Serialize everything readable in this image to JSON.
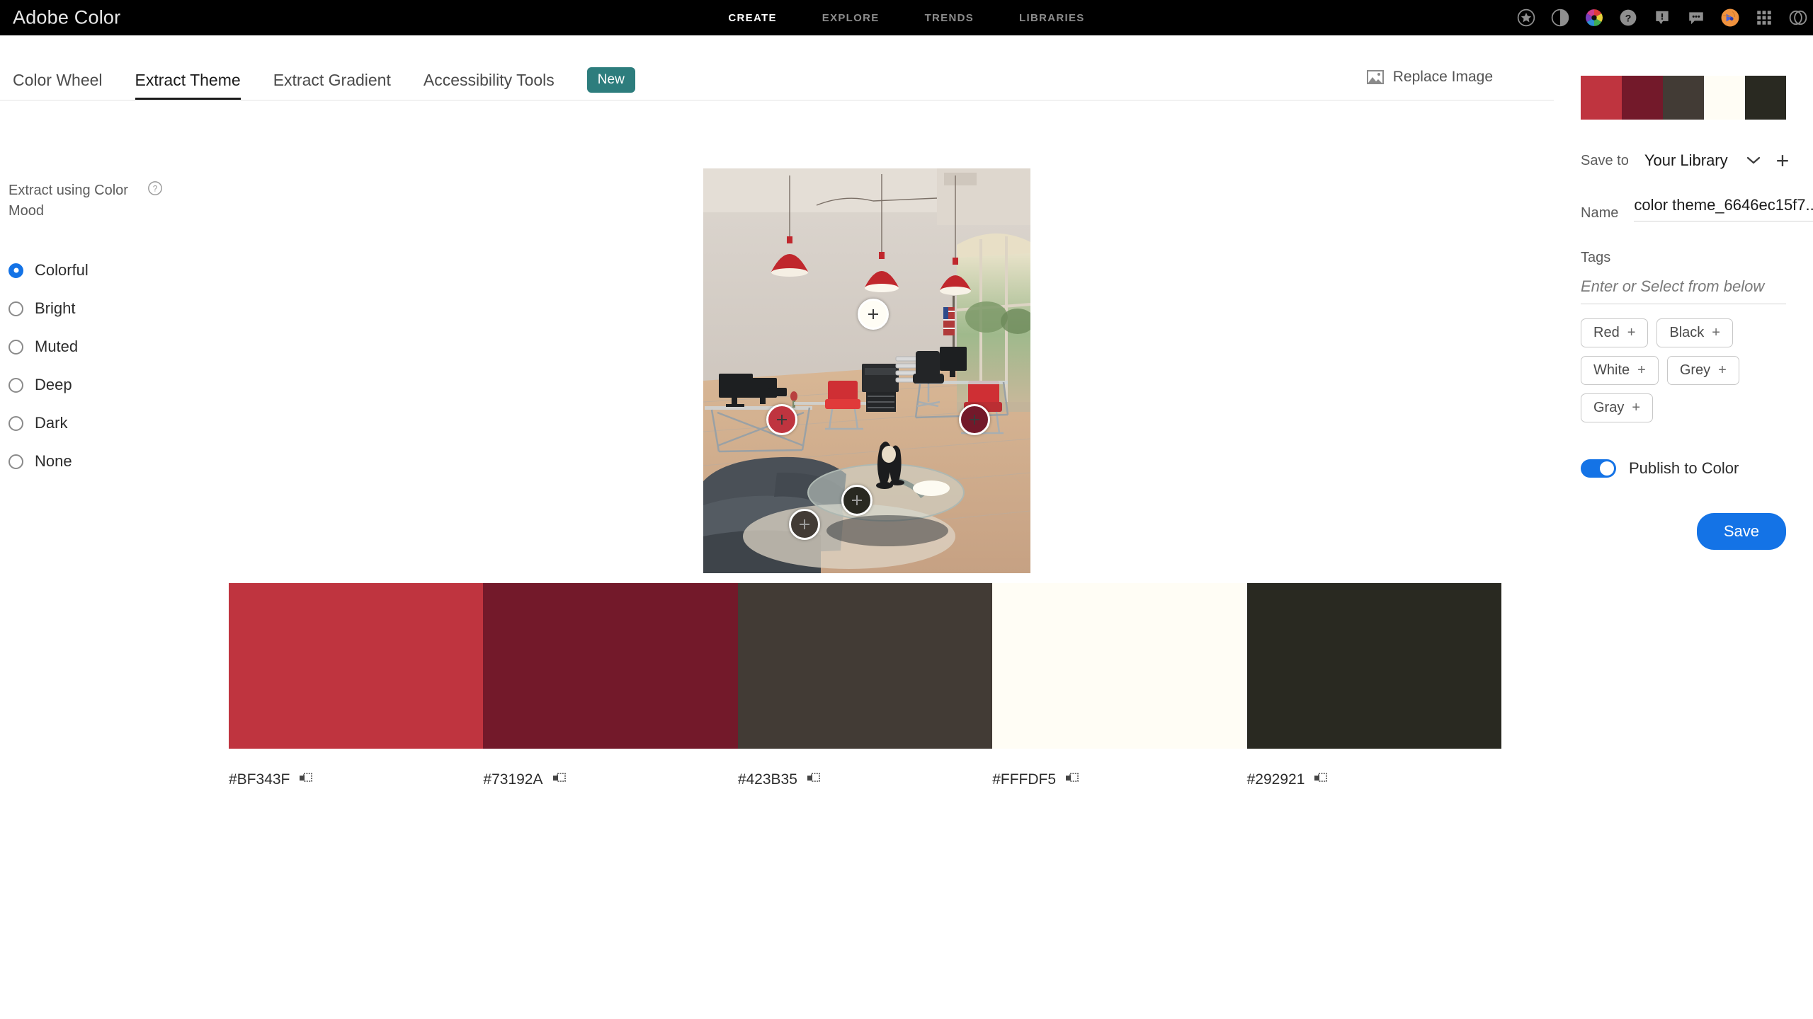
{
  "app": {
    "brand": "Adobe Color"
  },
  "topnav": {
    "items": [
      {
        "label": "CREATE",
        "active": true
      },
      {
        "label": "EXPLORE",
        "active": false
      },
      {
        "label": "TRENDS",
        "active": false
      },
      {
        "label": "LIBRARIES",
        "active": false
      }
    ],
    "icons": [
      "star-icon",
      "contrast-icon",
      "color-wheel-icon",
      "help-icon",
      "notification-icon",
      "chat-icon",
      "avatar",
      "app-grid-icon",
      "creative-cloud-icon"
    ]
  },
  "tabs": {
    "items": [
      {
        "label": "Color Wheel",
        "active": false
      },
      {
        "label": "Extract Theme",
        "active": true
      },
      {
        "label": "Extract Gradient",
        "active": false
      },
      {
        "label": "Accessibility Tools",
        "active": false
      }
    ],
    "badge": "New",
    "badge_color": "#2d7d7d",
    "replace_image": "Replace Image"
  },
  "left_panel": {
    "title": "Extract using Color Mood",
    "help_icon": "help-circle-icon",
    "options": [
      {
        "label": "Colorful",
        "selected": true
      },
      {
        "label": "Bright",
        "selected": false
      },
      {
        "label": "Muted",
        "selected": false
      },
      {
        "label": "Deep",
        "selected": false
      },
      {
        "label": "Dark",
        "selected": false
      },
      {
        "label": "None",
        "selected": false
      }
    ],
    "selected_color": "#1473e6"
  },
  "theme": {
    "swatches": [
      {
        "hex": "#BF343F",
        "copy_icon": "copy-icon"
      },
      {
        "hex": "#73192A",
        "copy_icon": "copy-icon"
      },
      {
        "hex": "#423B35",
        "copy_icon": "copy-icon"
      },
      {
        "hex": "#FFFDF5",
        "copy_icon": "copy-icon"
      },
      {
        "hex": "#292921",
        "copy_icon": "copy-icon"
      }
    ]
  },
  "image": {
    "description": "office interior with red pendant lamps",
    "markers": [
      {
        "x": 52,
        "y": 36,
        "size": 44,
        "fill": "#FFFDF5"
      },
      {
        "x": 24,
        "y": 62,
        "size": 44,
        "fill": "#BF343F"
      },
      {
        "x": 83,
        "y": 62,
        "size": 44,
        "fill": "#73192A"
      },
      {
        "x": 31,
        "y": 88,
        "size": 44,
        "fill": "#423B35"
      },
      {
        "x": 47,
        "y": 82,
        "size": 44,
        "fill": "#292921"
      }
    ]
  },
  "right_panel": {
    "save_to_label": "Save to",
    "library": "Your Library",
    "library_chevron": "chevron-down-icon",
    "add_icon": "plus-icon",
    "name_label": "Name",
    "name_value": "color theme_6646ec15f7...",
    "tags_label": "Tags",
    "tags_placeholder": "Enter or Select from below",
    "tag_chips": [
      "Red",
      "Black",
      "White",
      "Grey",
      "Gray"
    ],
    "chip_plus": "+",
    "publish_label": "Publish to Color",
    "publish_on": true,
    "save_label": "Save",
    "accent": "#1473e6"
  }
}
